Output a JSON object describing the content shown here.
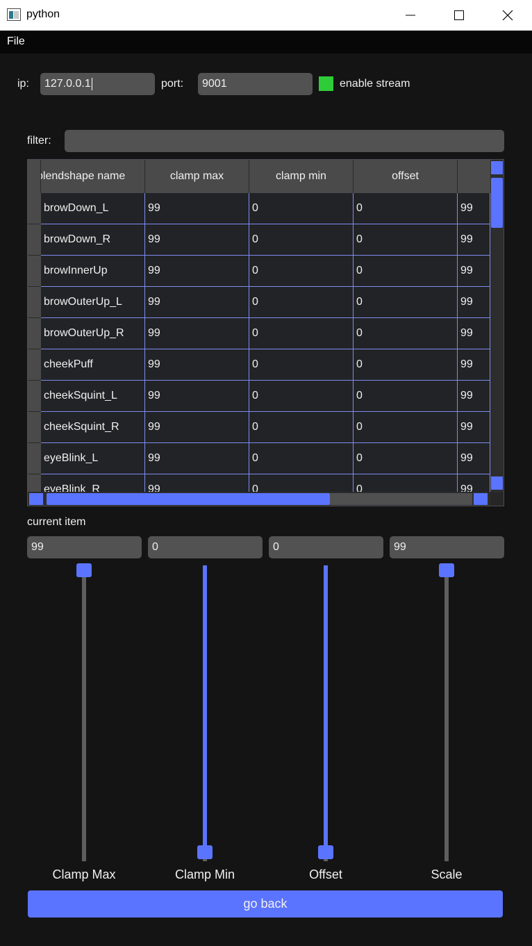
{
  "window": {
    "title": "python"
  },
  "menu": {
    "file": "File"
  },
  "connection": {
    "ip_label": "ip:",
    "ip_value": "127.0.0.1",
    "port_label": "port:",
    "port_value": "9001",
    "stream_label": "enable stream",
    "stream_enabled": true,
    "stream_color": "#2fcc3a"
  },
  "filter": {
    "label": "filter:",
    "value": ""
  },
  "table": {
    "headers": [
      "blendshape name",
      "clamp max",
      "clamp min",
      "offset",
      ""
    ],
    "rows": [
      [
        "browDown_L",
        "99",
        "0",
        "0",
        "99"
      ],
      [
        "browDown_R",
        "99",
        "0",
        "0",
        "99"
      ],
      [
        "browInnerUp",
        "99",
        "0",
        "0",
        "99"
      ],
      [
        "browOuterUp_L",
        "99",
        "0",
        "0",
        "99"
      ],
      [
        "browOuterUp_R",
        "99",
        "0",
        "0",
        "99"
      ],
      [
        "cheekPuff",
        "99",
        "0",
        "0",
        "99"
      ],
      [
        "cheekSquint_L",
        "99",
        "0",
        "0",
        "99"
      ],
      [
        "cheekSquint_R",
        "99",
        "0",
        "0",
        "99"
      ],
      [
        "eyeBlink_L",
        "99",
        "0",
        "0",
        "99"
      ],
      [
        "eyeBlink_R",
        "99",
        "0",
        "0",
        "99"
      ]
    ],
    "vertical_scroll_position": 0.0,
    "horizontal_scroll_position": 0.0
  },
  "current_item": {
    "label": "current item",
    "values": [
      "99",
      "0",
      "0",
      "99"
    ]
  },
  "sliders": [
    {
      "label": "Clamp Max",
      "level": 1.0
    },
    {
      "label": "Clamp Min",
      "level": 0.0
    },
    {
      "label": "Offset",
      "level": 0.0
    },
    {
      "label": "Scale",
      "level": 1.0
    }
  ],
  "go_back_label": "go back",
  "colors": {
    "accent": "#5b74ff",
    "background": "#141414",
    "field": "#525252"
  }
}
